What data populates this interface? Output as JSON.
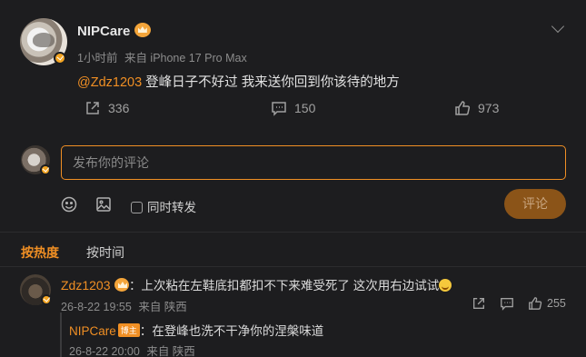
{
  "post": {
    "author": "NIPCare",
    "time": "1小时前",
    "source": "来自 iPhone 17 Pro Max",
    "mention": "@Zdz1203",
    "text": " 登峰日子不好过 我来送你回到你该待的地方",
    "shares": "336",
    "comments": "150",
    "likes": "973"
  },
  "composer": {
    "placeholder": "发布你的评论",
    "repost_label": "同时转发",
    "submit_label": "评论"
  },
  "sort_tabs": {
    "hot": "按热度",
    "time": "按时间"
  },
  "comment": {
    "author": "Zdz1203",
    "text": "：上次粘在左鞋底扣都扣不下来难受死了 这次用右边试试",
    "date": "26-8-22 19:55",
    "source": "来自 陕西",
    "likes": "255"
  },
  "reply": {
    "author": "NIPCare",
    "tag": "博主",
    "text": "：在登峰也洗不干净你的涅槃味道",
    "date": "26-8-22 20:00",
    "source": "来自 陕西"
  },
  "colors": {
    "accent": "#f08f24",
    "background": "#1d1d1f"
  }
}
